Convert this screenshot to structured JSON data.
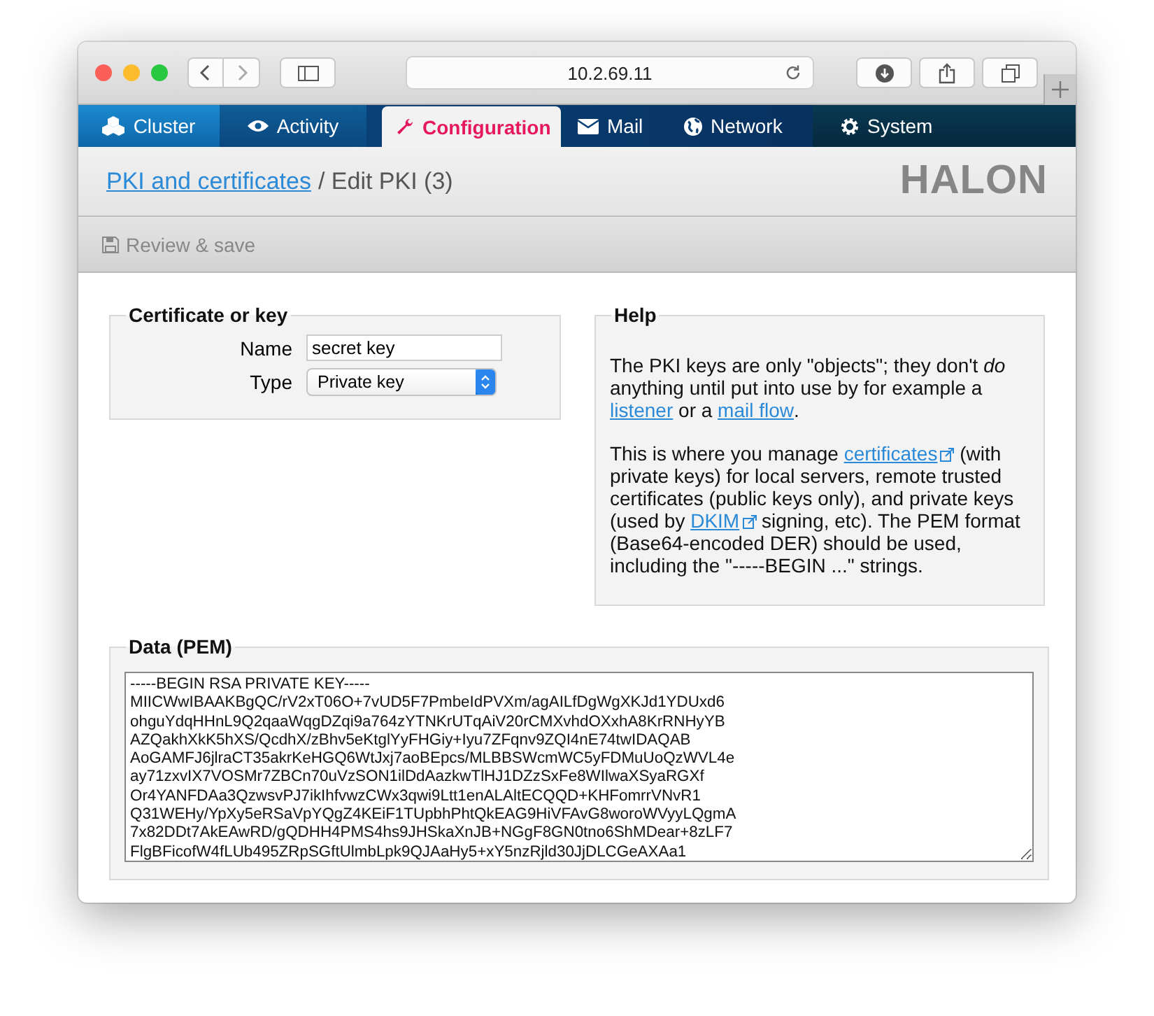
{
  "browser": {
    "address": "10.2.69.11"
  },
  "nav": {
    "tabs": [
      {
        "label": "Cluster",
        "selected": false
      },
      {
        "label": "Activity",
        "selected": false
      },
      {
        "label": "Configuration",
        "selected": true
      },
      {
        "label": "Mail",
        "selected": false
      },
      {
        "label": "Network",
        "selected": false
      },
      {
        "label": "System",
        "selected": false
      }
    ]
  },
  "breadcrumb": {
    "link": "PKI and certificates",
    "current": "/ Edit PKI (3)"
  },
  "logo": "HALON",
  "toolbar": {
    "save_button": "Review & save"
  },
  "form": {
    "title": "Certificate or key",
    "fields": [
      {
        "kind": "text",
        "label": "Name",
        "value": "secret key"
      },
      {
        "kind": "select",
        "label": "Type",
        "value": "Private key"
      }
    ]
  },
  "help": {
    "title": "Help",
    "paragraphs": [
      [
        {
          "text": "The PKI keys are only \"objects\"; they don't *do* anything until put into use by for example a "
        },
        {
          "link": "listener",
          "external": false
        },
        {
          "text": " or a "
        },
        {
          "link": "mail flow",
          "external": false
        },
        {
          "text": "."
        }
      ],
      [
        {
          "text": "This is where you manage "
        },
        {
          "link": "certificates",
          "external": true
        },
        {
          "text": " (with private keys) for local servers, remote trusted certificates (public keys only), and private keys (used by "
        },
        {
          "link": "DKIM",
          "external": true
        },
        {
          "text": " signing, etc). The PEM format (Base64-encoded DER) should be used, including the \"-----BEGIN ...\" strings."
        }
      ]
    ]
  },
  "data": {
    "title": "Data (PEM)",
    "lines": [
      "-----BEGIN RSA PRIVATE KEY-----",
      "MIICWwIBAAKBgQC/rV2xT06O+7vUD5F7PmbeIdPVXm/agAILfDgWgXKJd1YDUxd6",
      "ohguYdqHHnL9Q2qaaWqgDZqi9a764zYTNKrUTqAiV20rCMXvhdOXxhA8KrRNHyYB",
      "AZQakhXkK5hXS/QcdhX/zBhv5eKtglYyFHGiy+Iyu7ZFqnv9ZQI4nE74twIDAQAB",
      "AoGAMFJ6jlraCT35akrKeHGQ6WtJxj7aoBEpcs/MLBBSWcmWC5yFDMuUoQzWVL4e",
      "ay71zxvIX7VOSMr7ZBCn70uVzSON1ilDdAazkwTlHJ1DZzSxFe8WIlwaXSyaRGXf",
      "Or4YANFDAa3QzwsvPJ7ikIhfvwzCWx3qwi9Ltt1enALAltECQQD+KHFomrrVNvR1",
      "Q31WEHy/YpXy5eRSaVpYQgZ4KEiF1TUpbhPhtQkEAG9HiVFAvG8woroWVyyLQgmA",
      "7x82DDt7AkEAwRD/gQDHH4PMS4hs9JHSkaXnJB+NGgF8GN0tno6ShMDear+8zLF7",
      "FlgBFicofW4fLUb495ZRpSGftUlmbLpk9QJAaHy5+xY5nzRjld30JjDLCGeAXAa1"
    ]
  }
}
